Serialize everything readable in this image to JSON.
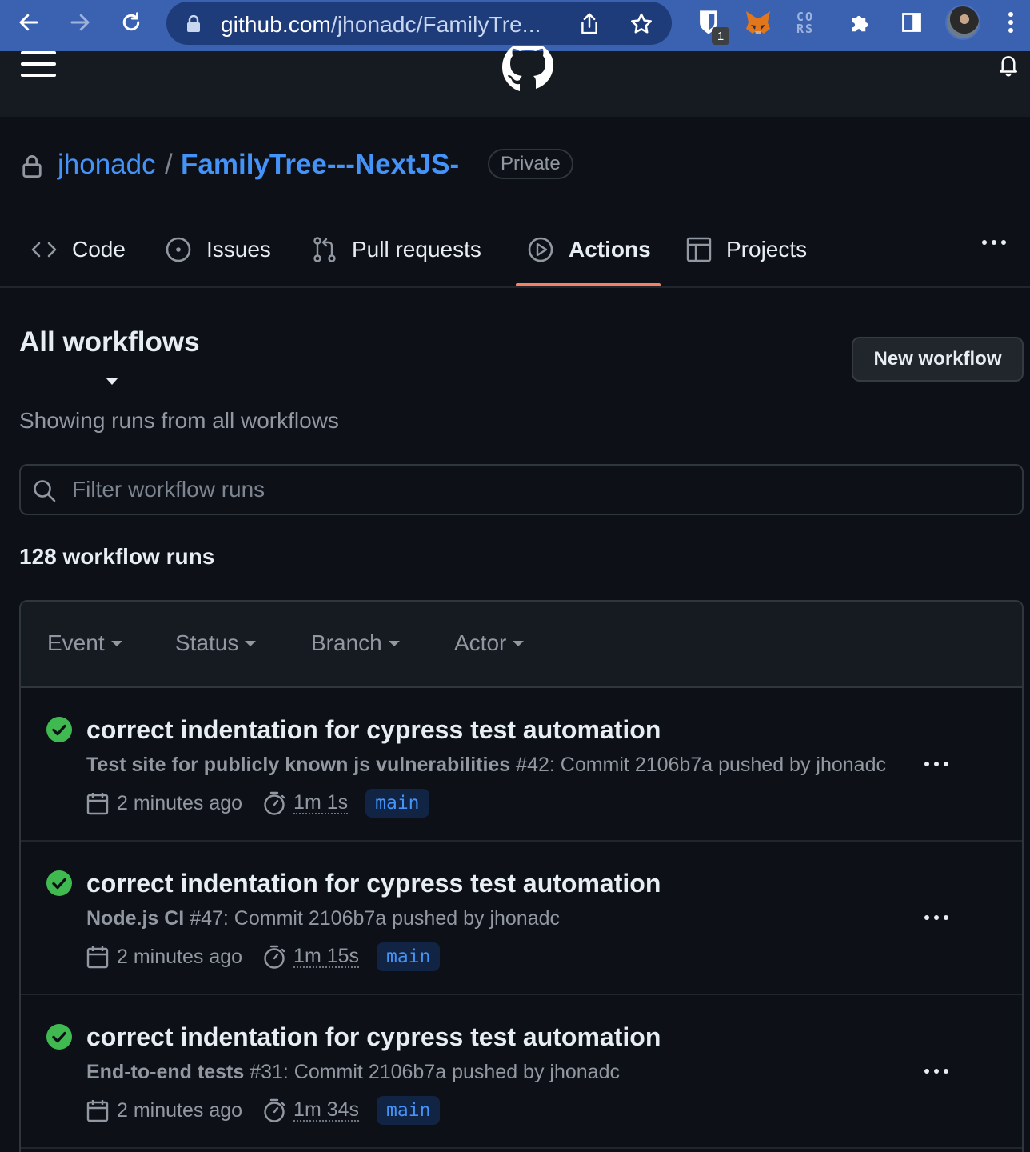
{
  "browser": {
    "url_host": "github.com",
    "url_rest": "/jhonadc/FamilyTre...",
    "extension_badge": "1",
    "cors_label_line1": "CO",
    "cors_label_line2": "RS"
  },
  "repo": {
    "owner": "jhonadc",
    "separator": "/",
    "name": "FamilyTree---NextJS-",
    "visibility": "Private"
  },
  "tabs": [
    {
      "label": "Code",
      "icon": "code-icon"
    },
    {
      "label": "Issues",
      "icon": "issue-opened-icon"
    },
    {
      "label": "Pull requests",
      "icon": "git-pull-request-icon"
    },
    {
      "label": "Actions",
      "icon": "play-icon",
      "active": true
    },
    {
      "label": "Projects",
      "icon": "table-icon"
    }
  ],
  "workflows": {
    "title": "All workflows",
    "subtitle": "Showing runs from all workflows",
    "new_button": "New workflow",
    "filter_placeholder": "Filter workflow runs",
    "run_count": "128 workflow runs",
    "filters": [
      "Event",
      "Status",
      "Branch",
      "Actor"
    ]
  },
  "runs": [
    {
      "title": "correct indentation for cypress test automation",
      "workflow": "Test site for publicly known js vulnerabilities",
      "detail": " #42: Commit 2106b7a pushed by jhonadc",
      "time": "2 minutes ago",
      "duration": "1m 1s",
      "branch": "main",
      "status": "success"
    },
    {
      "title": "correct indentation for cypress test automation",
      "workflow": "Node.js CI",
      "detail": " #47: Commit 2106b7a pushed by jhonadc",
      "time": "2 minutes ago",
      "duration": "1m 15s",
      "branch": "main",
      "status": "success"
    },
    {
      "title": "correct indentation for cypress test automation",
      "workflow": "End-to-end tests",
      "detail": " #31: Commit 2106b7a pushed by jhonadc",
      "time": "2 minutes ago",
      "duration": "1m 34s",
      "branch": "main",
      "status": "success"
    }
  ],
  "colors": {
    "background": "#0d1117",
    "link": "#4493f8",
    "success": "#3fb950",
    "active_tab_underline": "#f78166",
    "browser_chrome": "#3b62b0"
  }
}
